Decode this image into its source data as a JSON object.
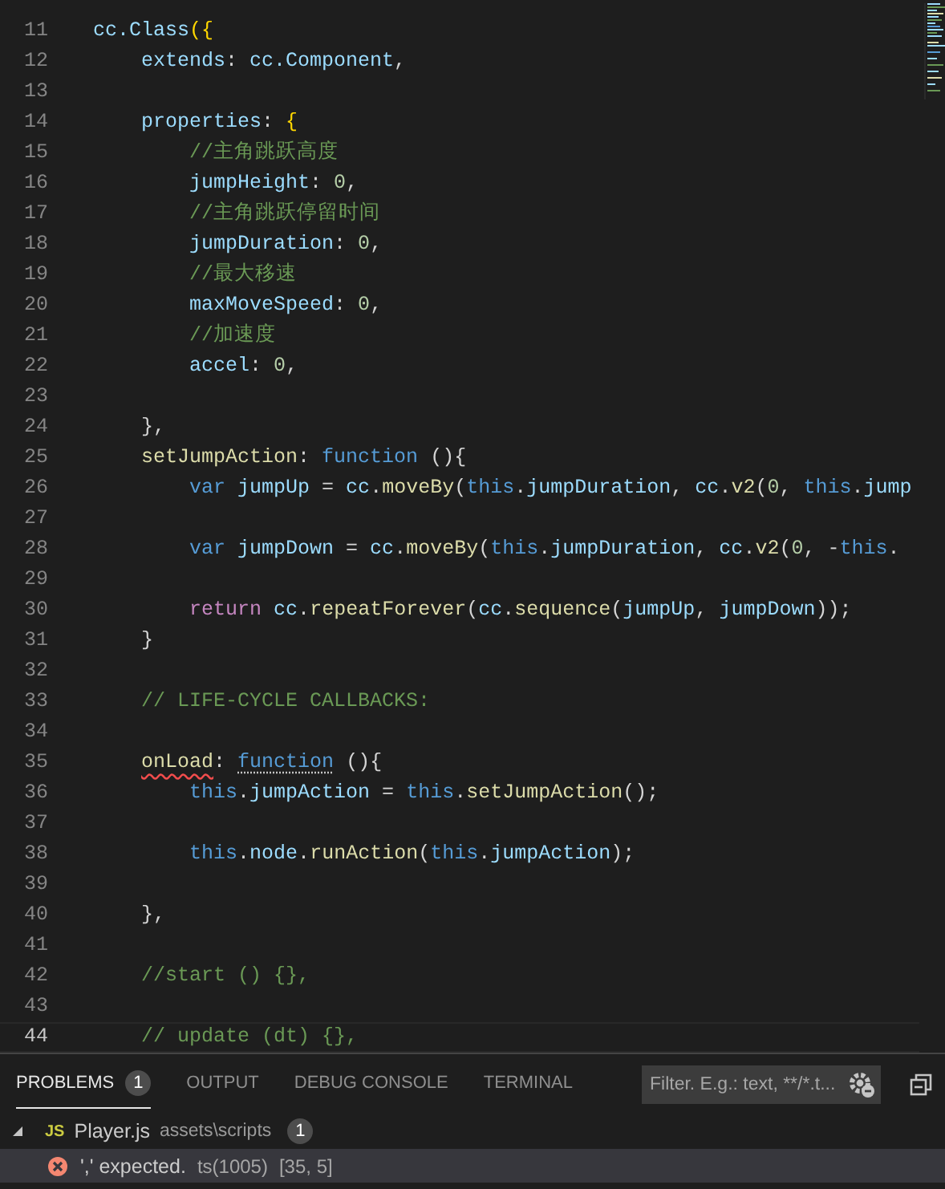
{
  "editor": {
    "lines": [
      {
        "n": "11",
        "current": false,
        "tokens": [
          {
            "t": "cc.Class",
            "kind": "variable"
          },
          {
            "t": "({",
            "kind": "bracket"
          }
        ]
      },
      {
        "n": "12",
        "current": false,
        "tokens": [
          {
            "t": "    extends",
            "kind": "variable"
          },
          {
            "t": ": ",
            "kind": "plain"
          },
          {
            "t": "cc.Component",
            "kind": "variable"
          },
          {
            "t": ",",
            "kind": "plain"
          }
        ]
      },
      {
        "n": "13",
        "current": false
      },
      {
        "n": "14",
        "current": false,
        "tokens": [
          {
            "t": "    properties",
            "kind": "variable"
          },
          {
            "t": ": ",
            "kind": "plain"
          },
          {
            "t": "{",
            "kind": "bracket"
          }
        ]
      },
      {
        "n": "15",
        "current": false,
        "tokens": [
          {
            "t": "        //主角跳跃高度",
            "kind": "comment"
          }
        ]
      },
      {
        "n": "16",
        "current": false,
        "tokens": [
          {
            "t": "        jumpHeight",
            "kind": "variable"
          },
          {
            "t": ": ",
            "kind": "plain"
          },
          {
            "t": "0",
            "kind": "number"
          },
          {
            "t": ",",
            "kind": "plain"
          }
        ]
      },
      {
        "n": "17",
        "current": false,
        "tokens": [
          {
            "t": "        //主角跳跃停留时间",
            "kind": "comment"
          }
        ]
      },
      {
        "n": "18",
        "current": false,
        "tokens": [
          {
            "t": "        jumpDuration",
            "kind": "variable"
          },
          {
            "t": ": ",
            "kind": "plain"
          },
          {
            "t": "0",
            "kind": "number"
          },
          {
            "t": ",",
            "kind": "plain"
          }
        ]
      },
      {
        "n": "19",
        "current": false,
        "tokens": [
          {
            "t": "        //最大移速",
            "kind": "comment"
          }
        ]
      },
      {
        "n": "20",
        "current": false,
        "tokens": [
          {
            "t": "        maxMoveSpeed",
            "kind": "variable"
          },
          {
            "t": ": ",
            "kind": "plain"
          },
          {
            "t": "0",
            "kind": "number"
          },
          {
            "t": ",",
            "kind": "plain"
          }
        ]
      },
      {
        "n": "21",
        "current": false,
        "tokens": [
          {
            "t": "        //加速度",
            "kind": "comment"
          }
        ]
      },
      {
        "n": "22",
        "current": false,
        "tokens": [
          {
            "t": "        accel",
            "kind": "variable"
          },
          {
            "t": ": ",
            "kind": "plain"
          },
          {
            "t": "0",
            "kind": "number"
          },
          {
            "t": ",",
            "kind": "plain"
          }
        ]
      },
      {
        "n": "23",
        "current": false
      },
      {
        "n": "24",
        "current": false,
        "tokens": [
          {
            "t": "    },",
            "kind": "plain"
          }
        ]
      },
      {
        "n": "25",
        "current": false,
        "tokens": [
          {
            "t": "    setJumpAction",
            "kind": "function"
          },
          {
            "t": ": ",
            "kind": "plain"
          },
          {
            "t": "function",
            "kind": "keyword"
          },
          {
            "t": " (){",
            "kind": "plain"
          }
        ]
      },
      {
        "n": "26",
        "current": false,
        "tokens": [
          {
            "t": "        var",
            "kind": "keyword"
          },
          {
            "t": " jumpUp",
            "kind": "variable"
          },
          {
            "t": " = ",
            "kind": "plain"
          },
          {
            "t": "cc",
            "kind": "variable"
          },
          {
            "t": ".",
            "kind": "plain"
          },
          {
            "t": "moveBy",
            "kind": "function"
          },
          {
            "t": "(",
            "kind": "plain"
          },
          {
            "t": "this",
            "kind": "keyword"
          },
          {
            "t": ".",
            "kind": "plain"
          },
          {
            "t": "jumpDuration",
            "kind": "variable"
          },
          {
            "t": ", ",
            "kind": "plain"
          },
          {
            "t": "cc",
            "kind": "variable"
          },
          {
            "t": ".",
            "kind": "plain"
          },
          {
            "t": "v2",
            "kind": "function"
          },
          {
            "t": "(",
            "kind": "plain"
          },
          {
            "t": "0",
            "kind": "number"
          },
          {
            "t": ", ",
            "kind": "plain"
          },
          {
            "t": "this",
            "kind": "keyword"
          },
          {
            "t": ".",
            "kind": "plain"
          },
          {
            "t": "jump",
            "kind": "variable"
          }
        ]
      },
      {
        "n": "27",
        "current": false
      },
      {
        "n": "28",
        "current": false,
        "tokens": [
          {
            "t": "        var",
            "kind": "keyword"
          },
          {
            "t": " jumpDown",
            "kind": "variable"
          },
          {
            "t": " = ",
            "kind": "plain"
          },
          {
            "t": "cc",
            "kind": "variable"
          },
          {
            "t": ".",
            "kind": "plain"
          },
          {
            "t": "moveBy",
            "kind": "function"
          },
          {
            "t": "(",
            "kind": "plain"
          },
          {
            "t": "this",
            "kind": "keyword"
          },
          {
            "t": ".",
            "kind": "plain"
          },
          {
            "t": "jumpDuration",
            "kind": "variable"
          },
          {
            "t": ", ",
            "kind": "plain"
          },
          {
            "t": "cc",
            "kind": "variable"
          },
          {
            "t": ".",
            "kind": "plain"
          },
          {
            "t": "v2",
            "kind": "function"
          },
          {
            "t": "(",
            "kind": "plain"
          },
          {
            "t": "0",
            "kind": "number"
          },
          {
            "t": ", -",
            "kind": "plain"
          },
          {
            "t": "this",
            "kind": "keyword"
          },
          {
            "t": ".",
            "kind": "plain"
          }
        ]
      },
      {
        "n": "29",
        "current": false
      },
      {
        "n": "30",
        "current": false,
        "tokens": [
          {
            "t": "        return",
            "kind": "control"
          },
          {
            "t": " cc",
            "kind": "variable"
          },
          {
            "t": ".",
            "kind": "plain"
          },
          {
            "t": "repeatForever",
            "kind": "function"
          },
          {
            "t": "(",
            "kind": "plain"
          },
          {
            "t": "cc",
            "kind": "variable"
          },
          {
            "t": ".",
            "kind": "plain"
          },
          {
            "t": "sequence",
            "kind": "function"
          },
          {
            "t": "(",
            "kind": "plain"
          },
          {
            "t": "jumpUp",
            "kind": "variable"
          },
          {
            "t": ", ",
            "kind": "plain"
          },
          {
            "t": "jumpDown",
            "kind": "variable"
          },
          {
            "t": "));",
            "kind": "plain"
          }
        ]
      },
      {
        "n": "31",
        "current": false,
        "tokens": [
          {
            "t": "    }",
            "kind": "plain"
          }
        ]
      },
      {
        "n": "32",
        "current": false
      },
      {
        "n": "33",
        "current": false,
        "tokens": [
          {
            "t": "    // LIFE-CYCLE CALLBACKS:",
            "kind": "comment"
          }
        ]
      },
      {
        "n": "34",
        "current": false
      },
      {
        "n": "35",
        "current": false,
        "tokens": [
          {
            "t": "    onLoad",
            "kind": "function",
            "error": true
          },
          {
            "t": ": ",
            "kind": "plain"
          },
          {
            "t": "function",
            "kind": "keyword",
            "hint": true
          },
          {
            "t": " (){",
            "kind": "plain"
          }
        ]
      },
      {
        "n": "36",
        "current": false,
        "tokens": [
          {
            "t": "        this",
            "kind": "keyword"
          },
          {
            "t": ".",
            "kind": "plain"
          },
          {
            "t": "jumpAction",
            "kind": "variable"
          },
          {
            "t": " = ",
            "kind": "plain"
          },
          {
            "t": "this",
            "kind": "keyword"
          },
          {
            "t": ".",
            "kind": "plain"
          },
          {
            "t": "setJumpAction",
            "kind": "function"
          },
          {
            "t": "();",
            "kind": "plain"
          }
        ]
      },
      {
        "n": "37",
        "current": false
      },
      {
        "n": "38",
        "current": false,
        "tokens": [
          {
            "t": "        this",
            "kind": "keyword"
          },
          {
            "t": ".",
            "kind": "plain"
          },
          {
            "t": "node",
            "kind": "variable"
          },
          {
            "t": ".",
            "kind": "plain"
          },
          {
            "t": "runAction",
            "kind": "function"
          },
          {
            "t": "(",
            "kind": "plain"
          },
          {
            "t": "this",
            "kind": "keyword"
          },
          {
            "t": ".",
            "kind": "plain"
          },
          {
            "t": "jumpAction",
            "kind": "variable"
          },
          {
            "t": ");",
            "kind": "plain"
          }
        ]
      },
      {
        "n": "39",
        "current": false
      },
      {
        "n": "40",
        "current": false,
        "tokens": [
          {
            "t": "    },",
            "kind": "plain"
          }
        ]
      },
      {
        "n": "41",
        "current": false
      },
      {
        "n": "42",
        "current": false,
        "tokens": [
          {
            "t": "    //start () {},",
            "kind": "comment"
          }
        ]
      },
      {
        "n": "43",
        "current": false
      },
      {
        "n": "44",
        "current": true,
        "tokens": [
          {
            "t": "    // update (dt) {},",
            "kind": "comment"
          }
        ]
      }
    ]
  },
  "panel": {
    "tabs": [
      {
        "label": "PROBLEMS",
        "badge": "1",
        "selected": true
      },
      {
        "label": "OUTPUT",
        "selected": false
      },
      {
        "label": "DEBUG CONSOLE",
        "selected": false
      },
      {
        "label": "TERMINAL",
        "selected": false
      }
    ],
    "filter": {
      "placeholder": "Filter. E.g.: text, **/*.t..."
    },
    "problems": [
      {
        "file_icon": "JS",
        "file": "Player.js",
        "path": "assets\\scripts",
        "count": "1",
        "expanded": true,
        "children": [
          {
            "message": "',' expected.",
            "code": "ts(1005)",
            "location": "[35, 5]",
            "selected": true
          }
        ]
      }
    ]
  }
}
